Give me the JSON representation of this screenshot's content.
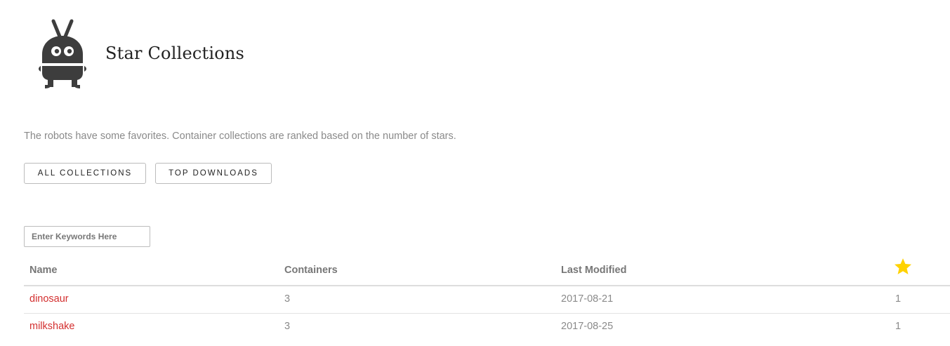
{
  "header": {
    "title": "Star Collections"
  },
  "intro": "The robots have some favorites. Container collections are ranked based on the number of stars.",
  "buttons": {
    "all_collections": "All Collections",
    "top_downloads": "Top Downloads"
  },
  "search": {
    "placeholder": "Enter Keywords Here",
    "value": ""
  },
  "table": {
    "columns": {
      "name": "Name",
      "containers": "Containers",
      "last_modified": "Last Modified",
      "stars_icon": "star-icon"
    },
    "rows": [
      {
        "name": "dinosaur",
        "containers": "3",
        "last_modified": "2017-08-21",
        "stars": "1"
      },
      {
        "name": "milkshake",
        "containers": "3",
        "last_modified": "2017-08-25",
        "stars": "1"
      }
    ]
  },
  "colors": {
    "link": "#d32f2f",
    "star": "#ffd200",
    "logo": "#3d3d3d",
    "muted_text": "#8a8a8a"
  },
  "icons": {
    "logo": "robot-logo-icon",
    "star": "star-icon"
  }
}
